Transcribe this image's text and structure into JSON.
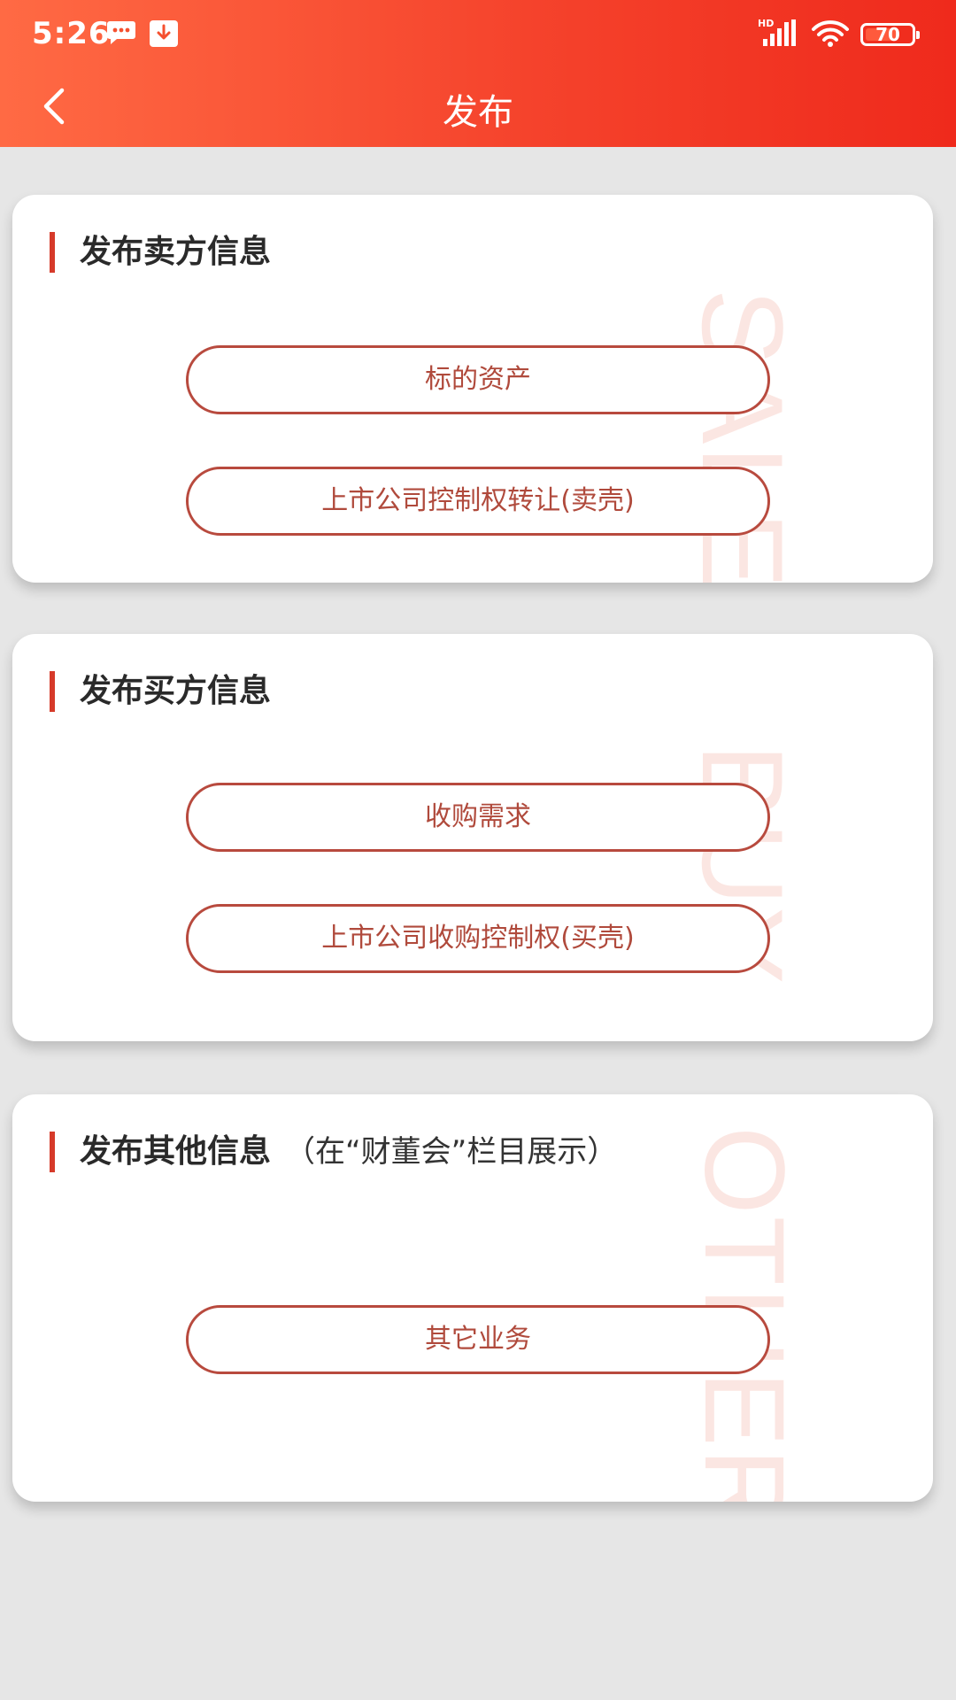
{
  "status_bar": {
    "time": "5:26",
    "battery": "70",
    "battery_fraction": 0.7
  },
  "nav": {
    "title": "发布"
  },
  "icons": {
    "back": "chevron-left-icon",
    "message": "message-icon",
    "download": "download-icon",
    "signal": "signal-icon",
    "wifi": "wifi-icon",
    "battery": "battery-icon"
  },
  "colors": {
    "header_start": "#ff6a44",
    "header_end": "#ef2a1c",
    "accent": "#d63a2a",
    "pill_border": "#b84a3e",
    "pill_text": "#b04a3c",
    "watermark": "#fbe6e2",
    "background": "#e6e6e6"
  },
  "sections": {
    "seller": {
      "title": "发布卖方信息",
      "watermark": "SALE",
      "buttons": [
        "标的资产",
        "上市公司控制权转让(卖壳)"
      ]
    },
    "buyer": {
      "title": "发布买方信息",
      "watermark": "BUY",
      "buttons": [
        "收购需求",
        "上市公司收购控制权(买壳)"
      ]
    },
    "others": {
      "title": "发布其他信息",
      "subtitle": "（在“财董会”栏目展示）",
      "watermark": "OTHERS",
      "buttons": [
        "其它业务"
      ]
    }
  }
}
